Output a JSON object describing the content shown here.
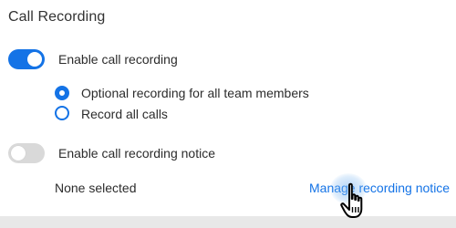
{
  "section": {
    "title": "Call Recording"
  },
  "enable_recording": {
    "label": "Enable call recording",
    "enabled": true
  },
  "recording_mode": {
    "options": [
      {
        "label": "Optional recording for all team members",
        "selected": true
      },
      {
        "label": "Record all calls",
        "selected": false
      }
    ]
  },
  "recording_notice": {
    "label": "Enable call recording notice",
    "enabled": false,
    "status": "None selected",
    "manage_link": "Manage recording notice"
  },
  "colors": {
    "accent": "#1473e6",
    "toggle_off": "#d9d9d9",
    "text": "#2c2c2c",
    "footer": "#e8e8e8"
  },
  "icons": {
    "cursor": "hand-pointer-icon"
  }
}
